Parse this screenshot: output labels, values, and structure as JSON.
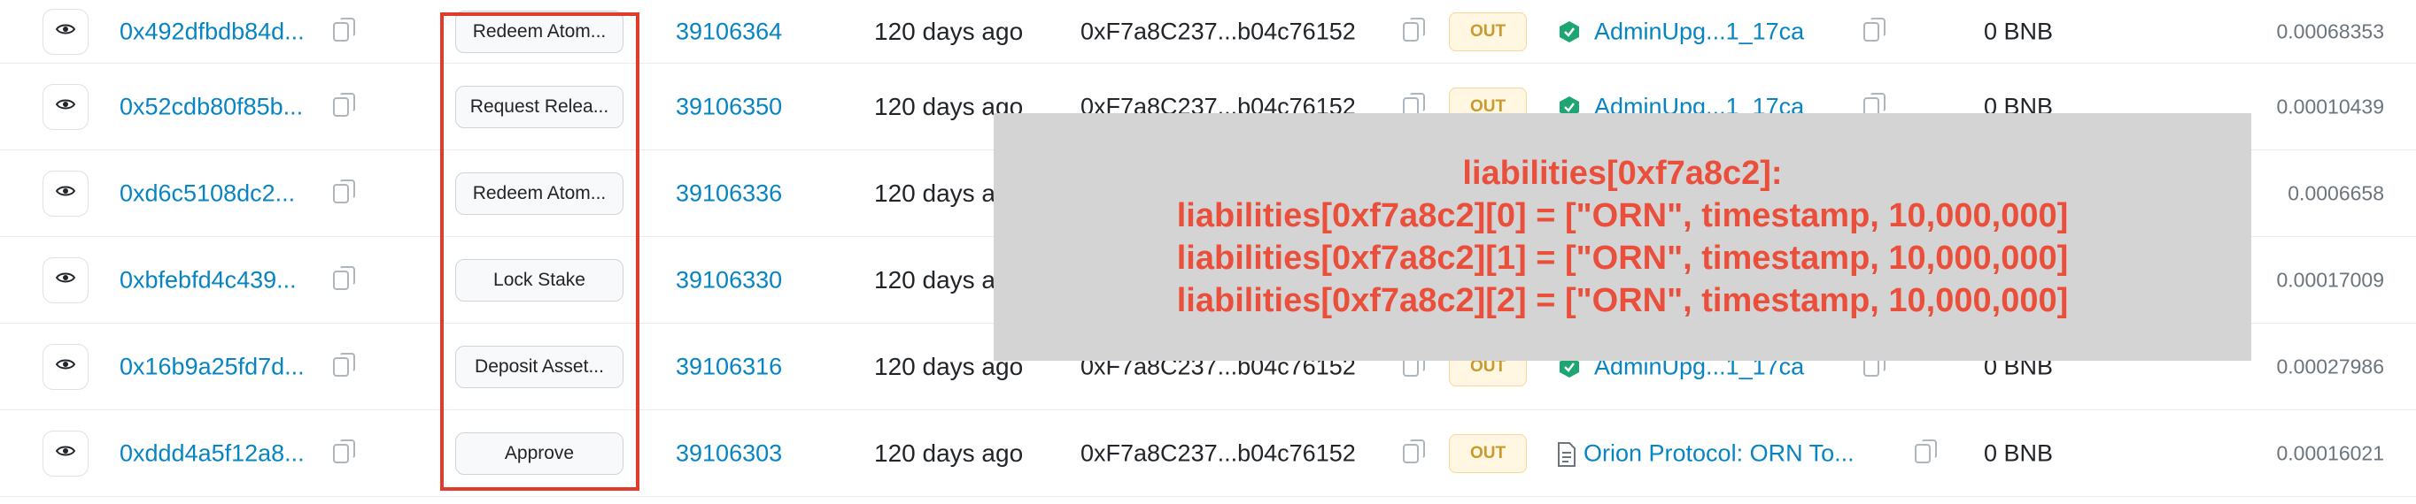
{
  "rows": [
    {
      "hash": "0x492dfbdb84d...",
      "method": "Redeem Atom...",
      "block": "39106364",
      "age": "120 days ago",
      "from": "0xF7a8C237...b04c76152",
      "direction": "OUT",
      "to": "AdminUpg...1_17ca",
      "to_icon": "contract-check-icon",
      "value": "0 BNB",
      "fee": "0.00068353"
    },
    {
      "hash": "0x52cdb80f85b...",
      "method": "Request Relea...",
      "block": "39106350",
      "age": "120 days ago",
      "from": "0xF7a8C237...b04c76152",
      "direction": "OUT",
      "to": "AdminUpg...1_17ca",
      "to_icon": "contract-check-icon",
      "value": "0 BNB",
      "fee": "0.00010439"
    },
    {
      "hash": "0xd6c5108dc2...",
      "method": "Redeem Atom...",
      "block": "39106336",
      "age": "120 days ago",
      "from": "",
      "direction": "",
      "to": "",
      "to_icon": "",
      "value": "",
      "fee": "0.0006658"
    },
    {
      "hash": "0xbfebfd4c439...",
      "method": "Lock Stake",
      "block": "39106330",
      "age": "120 days ago",
      "from": "",
      "direction": "",
      "to": "",
      "to_icon": "",
      "value": "",
      "fee": "0.00017009"
    },
    {
      "hash": "0x16b9a25fd7d...",
      "method": "Deposit Asset...",
      "block": "39106316",
      "age": "120 days ago",
      "from": "0xF7a8C237...b04c76152",
      "direction": "OUT",
      "to": "AdminUpg...1_17ca",
      "to_icon": "contract-check-icon",
      "value": "0 BNB",
      "fee": "0.00027986"
    },
    {
      "hash": "0xddd4a5f12a8...",
      "method": "Approve",
      "block": "39106303",
      "age": "120 days ago",
      "from": "0xF7a8C237...b04c76152",
      "direction": "OUT",
      "to": "Orion Protocol: ORN To...",
      "to_icon": "document-icon",
      "value": "0 BNB",
      "fee": "0.00016021"
    }
  ],
  "overlay": {
    "lines": [
      "liabilities[0xf7a8c2]:",
      "liabilities[0xf7a8c2][0] = [\"ORN\", timestamp, 10,000,000]",
      "liabilities[0xf7a8c2][1] = [\"ORN\", timestamp, 10,000,000]",
      "liabilities[0xf7a8c2][2] = [\"ORN\", timestamp, 10,000,000]"
    ],
    "text_color": "#ea4f3c",
    "background": "#d4d4d4"
  },
  "colors": {
    "link": "#0784c3",
    "highlight_border": "#e23b2e",
    "out_badge_bg": "#fff7e1",
    "out_badge_text": "#c99a2e",
    "contract_icon": "#1ea672"
  }
}
